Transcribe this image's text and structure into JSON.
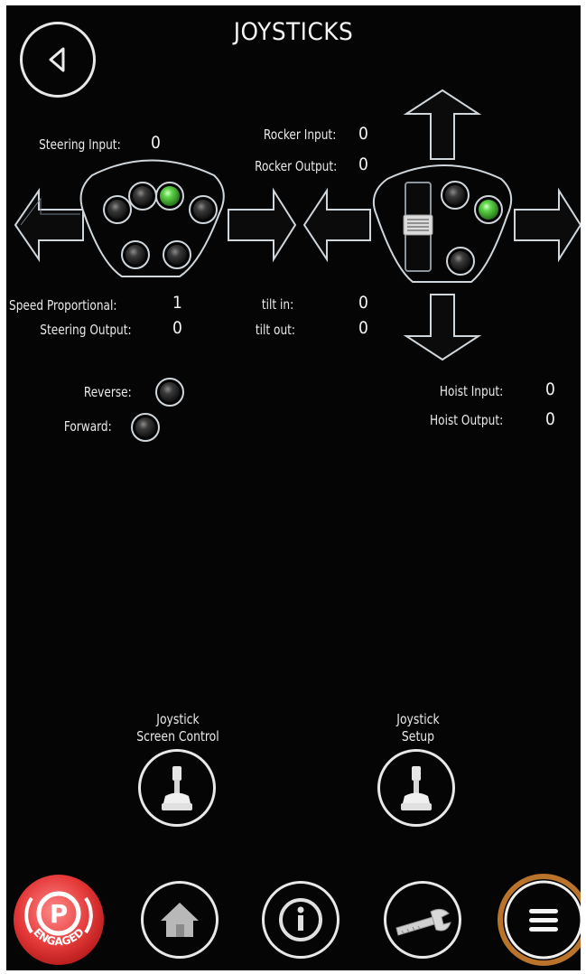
{
  "header": {
    "title": "JOYSTICKS",
    "back_icon": "back-triangle-icon"
  },
  "steering": {
    "input_label": "Steering Input:",
    "input_value": "0",
    "speed_prop_label": "Speed Proportional:",
    "speed_prop_value": "1",
    "output_label": "Steering Output:",
    "output_value": "0",
    "leds": [
      {
        "name": "left-joystick-led-1",
        "state": "off"
      },
      {
        "name": "left-joystick-led-2",
        "state": "off"
      },
      {
        "name": "left-joystick-led-3",
        "state": "on"
      },
      {
        "name": "left-joystick-led-4",
        "state": "off"
      },
      {
        "name": "left-joystick-led-5",
        "state": "off"
      },
      {
        "name": "left-joystick-led-6",
        "state": "off"
      }
    ]
  },
  "rocker": {
    "input_label": "Rocker Input:",
    "input_value": "0",
    "output_label": "Rocker Output:",
    "output_value": "0",
    "tilt_in_label": "tilt in:",
    "tilt_in_value": "0",
    "tilt_out_label": "tilt out:",
    "tilt_out_value": "0",
    "leds": [
      {
        "name": "right-joystick-led-1",
        "state": "off"
      },
      {
        "name": "right-joystick-led-2",
        "state": "on"
      },
      {
        "name": "right-joystick-led-3",
        "state": "off"
      }
    ]
  },
  "direction": {
    "reverse_label": "Reverse:",
    "forward_label": "Forward:",
    "reverse_state": "off",
    "forward_state": "off"
  },
  "hoist": {
    "input_label": "Hoist Input:",
    "input_value": "0",
    "output_label": "Hoist Output:",
    "output_value": "0"
  },
  "actions": {
    "screen_control_line1": "Joystick",
    "screen_control_line2": "Screen Control",
    "setup_line1": "Joystick",
    "setup_line2": "Setup"
  },
  "nav": {
    "park_letter": "P",
    "park_status": "ENGAGED",
    "items": [
      "home-icon",
      "info-icon",
      "wrench-icon",
      "menu-icon"
    ]
  },
  "colors": {
    "background": "#050505",
    "led_on": "#3fbf2a",
    "led_off": "#1c1c1c",
    "park_red": "#e53a3a",
    "menu_ring": "#b9732b"
  }
}
